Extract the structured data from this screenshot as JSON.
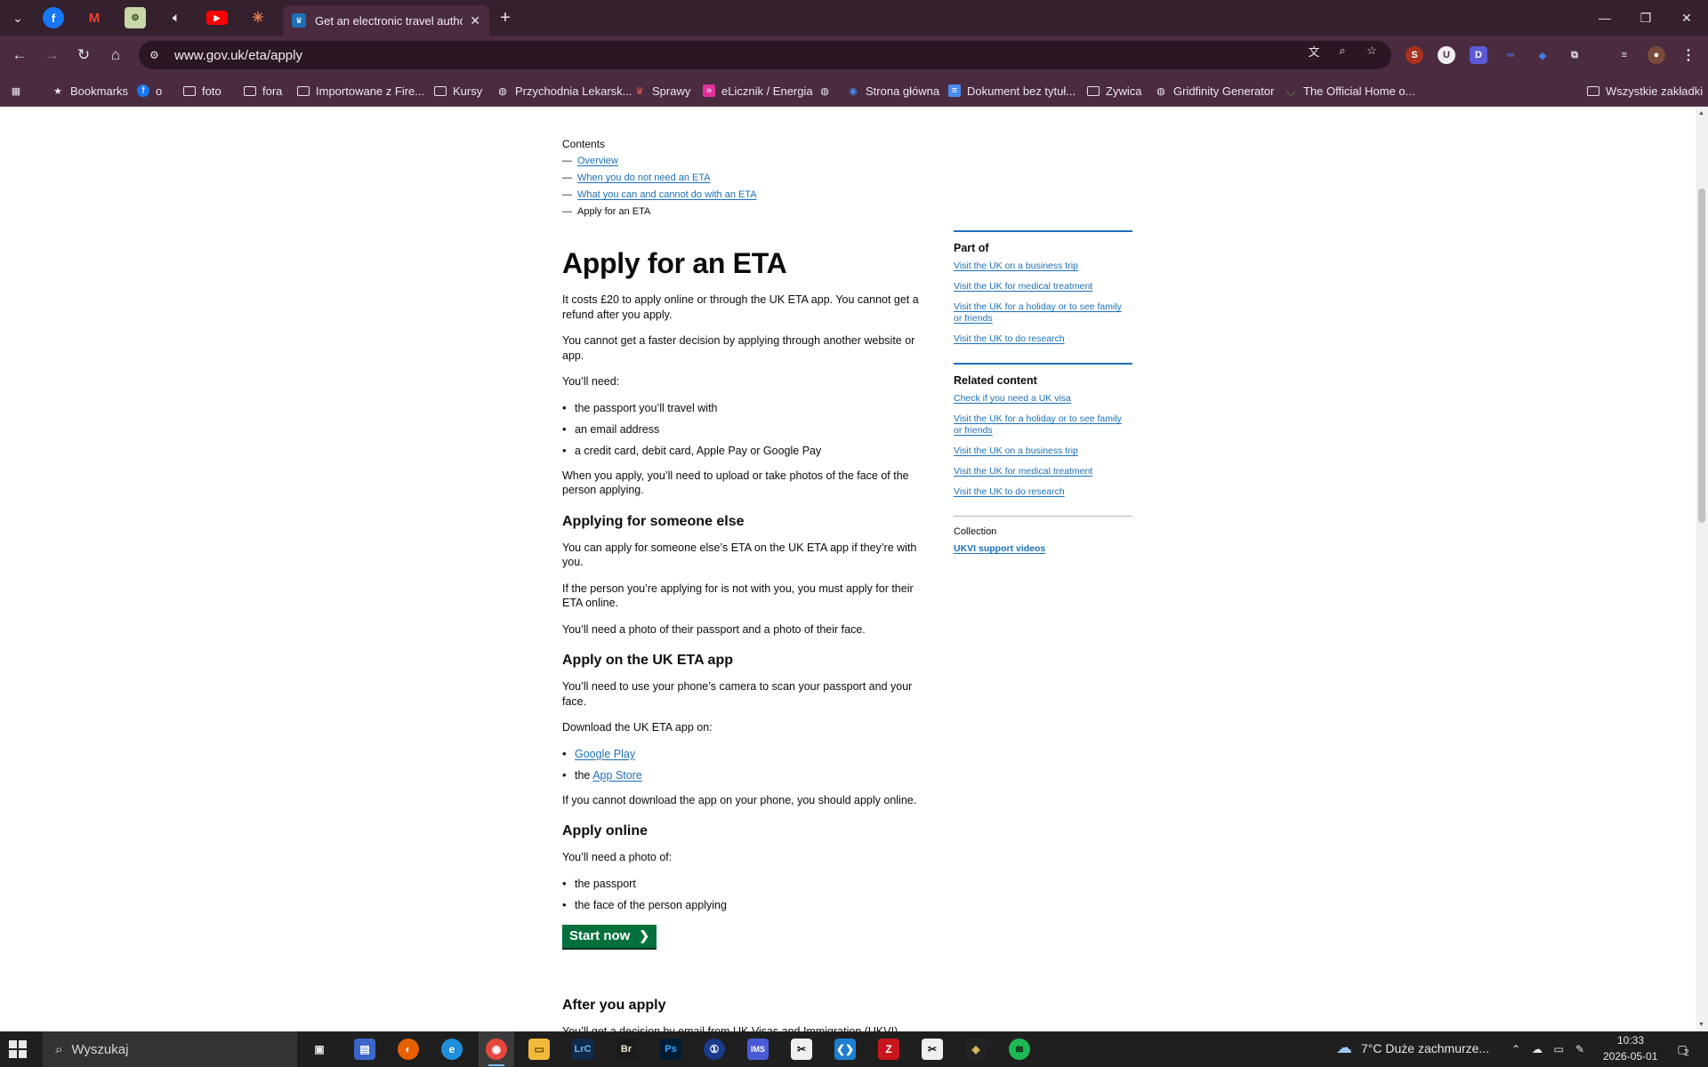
{
  "browser": {
    "active_tab_title": "Get an electronic travel authori",
    "url": "www.gov.uk/eta/apply",
    "bookmarks": [
      "Bookmarks",
      "o",
      "foto",
      "fora",
      "Importowane z Fire...",
      "Kursy",
      "Przychodnia Lekarsk...",
      "Sprawy",
      "eLicznik / Energia",
      "Strona główna",
      "Dokument bez tytuł...",
      "Zywica",
      "Gridfinity Generator",
      "The Official Home o...",
      "Wszystkie zakładki"
    ]
  },
  "contents": {
    "title": "Contents",
    "items": [
      {
        "label": "Overview"
      },
      {
        "label": "When you do not need an ETA"
      },
      {
        "label": "What you can and cannot do with an ETA"
      },
      {
        "label": "Apply for an ETA"
      }
    ]
  },
  "main": {
    "h1": "Apply for an ETA",
    "p1": "It costs £20 to apply online or through the UK ETA app. You cannot get a refund after you apply.",
    "p2": "You cannot get a faster decision by applying through another website or app.",
    "p3": "You’ll need:",
    "needs": [
      "the passport you’ll travel with",
      "an email address",
      "a credit card, debit card, Apple Pay or Google Pay"
    ],
    "p4": "When you apply, you’ll need to upload or take photos of the face of the person applying.",
    "h2_someone": "Applying for someone else",
    "p5": "You can apply for someone else’s ETA on the UK ETA app if they’re with you.",
    "p6": "If the person you’re applying for is not with you, you must apply for their ETA online.",
    "p7": "You’ll need a photo of their passport and a photo of their face.",
    "h2_app": "Apply on the UK ETA app",
    "p8": "You’ll need to use your phone’s camera to scan your passport and your face.",
    "p9": "Download the UK ETA app on:",
    "google_play": "Google Play",
    "the": "the",
    "app_store": "App Store",
    "p10": "If you cannot download the app on your phone, you should apply online.",
    "h2_online": "Apply online",
    "p11": "You’ll need a photo of:",
    "photos": [
      "the passport",
      "the face of the person applying"
    ],
    "start_label": "Start now",
    "h2_after": "After you apply",
    "p12": "You’ll get a decision by email from UK Visas and Immigration (UKVI), usually"
  },
  "sidebar": {
    "part_of_title": "Part of",
    "part_of": [
      "Visit the UK on a business trip",
      "Visit the UK for medical treatment",
      "Visit the UK for a holiday or to see family or friends",
      "Visit the UK to do research"
    ],
    "related_title": "Related content",
    "related": [
      "Check if you need a UK visa",
      "Visit the UK for a holiday or to see family or friends",
      "Visit the UK on a business trip",
      "Visit the UK for medical treatment",
      "Visit the UK to do research"
    ],
    "collection_title": "Collection",
    "collection": "UKVI support videos"
  },
  "taskbar": {
    "search_placeholder": "Wyszukaj",
    "weather": "7°C  Duże zachmurze...",
    "time": "10:33",
    "date": "2026-05-01",
    "notifications": "2"
  },
  "colors": {
    "link": "#1d70b8",
    "start_button": "#00703c",
    "browser_frame": "#35202e",
    "browser_toolbar": "#4a2b40"
  }
}
